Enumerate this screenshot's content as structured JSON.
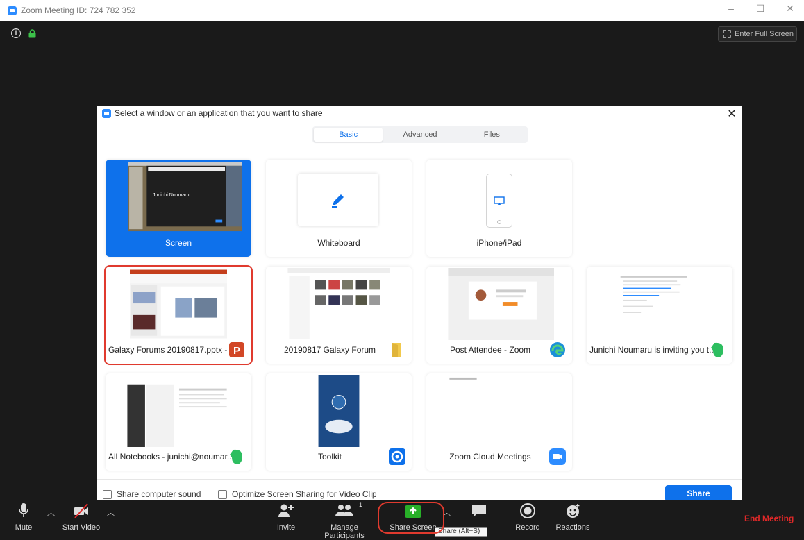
{
  "window": {
    "title": "Zoom Meeting ID: 724 782 352",
    "fullscreen_label": "Enter Full Screen"
  },
  "dialog": {
    "title": "Select a window or an application that you want to share",
    "tabs": [
      {
        "label": "Basic",
        "active": true
      },
      {
        "label": "Advanced",
        "active": false
      },
      {
        "label": "Files",
        "active": false
      }
    ],
    "tiles": [
      {
        "label": "Screen",
        "icon": "monitor-thumbnail",
        "selected": true
      },
      {
        "label": "Whiteboard",
        "icon": "pen-icon"
      },
      {
        "label": "iPhone/iPad",
        "icon": "airplay-icon"
      },
      {
        "label": "Galaxy Forums 20190817.pptx - ...",
        "icon": "powerpoint-icon",
        "circled": true
      },
      {
        "label": "20190817 Galaxy Forum",
        "icon": "folder-icon"
      },
      {
        "label": "Post Attendee - Zoom",
        "icon": "edge-icon"
      },
      {
        "label": "Junichi Noumaru is inviting you t...",
        "icon": "evernote-icon"
      },
      {
        "label": "All Notebooks - junichi@noumar...",
        "icon": "evernote-icon"
      },
      {
        "label": "Toolkit",
        "icon": "toolkit-icon"
      },
      {
        "label": "Zoom Cloud Meetings",
        "icon": "zoom-icon"
      }
    ],
    "screen_thumb_text": "Junichi Noumaru",
    "share_sound_label": "Share computer sound",
    "optimize_label": "Optimize Screen Sharing for Video Clip",
    "share_button": "Share"
  },
  "toolbar": {
    "mute": "Mute",
    "start_video": "Start Video",
    "invite": "Invite",
    "manage_participants": "Manage Participants",
    "participant_count": "1",
    "share_screen": "Share Screen",
    "chat_tooltip": "Share (Alt+S)",
    "record": "Record",
    "reactions": "Reactions",
    "end_meeting": "End Meeting"
  },
  "colors": {
    "accent": "#0e71eb",
    "end_meeting": "#e02828",
    "share_green": "#28b028",
    "annotation_red": "#e03a2e"
  }
}
